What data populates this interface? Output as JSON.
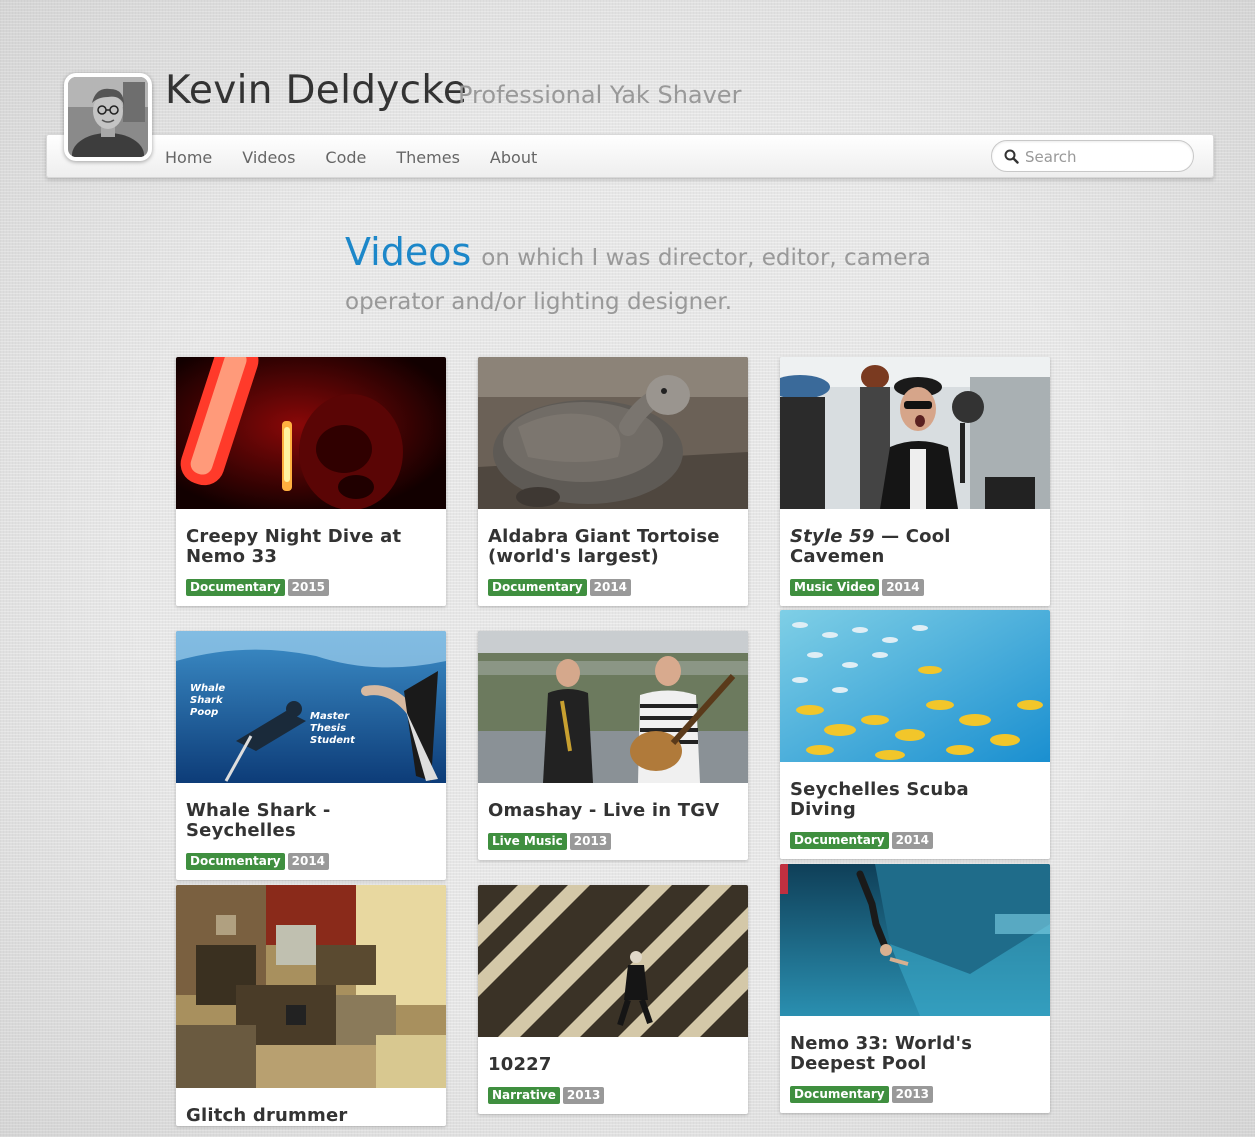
{
  "site": {
    "name": "Kevin Deldycke",
    "tagline": "Professional Yak Shaver"
  },
  "nav": {
    "items": [
      {
        "label": "Home"
      },
      {
        "label": "Videos"
      },
      {
        "label": "Code"
      },
      {
        "label": "Themes"
      },
      {
        "label": "About"
      }
    ]
  },
  "search": {
    "placeholder": "Search",
    "value": "",
    "icon": "search-icon"
  },
  "heading": {
    "title": "Videos",
    "subtitle_line1": "on which I was director, editor, camera",
    "subtitle_line2": "operator and/or lighting designer."
  },
  "videos": [
    {
      "title": "Creepy Night Dive at Nemo 33",
      "genre": "Documentary",
      "year": "2015"
    },
    {
      "title": "Aldabra Giant Tortoise (world's largest)",
      "genre": "Documentary",
      "year": "2014"
    },
    {
      "title_em": "Style 59",
      "title_rest": " — Cool Cavemen",
      "genre": "Music Video",
      "year": "2014"
    },
    {
      "title": "Whale Shark - Seychelles",
      "genre": "Documentary",
      "year": "2014",
      "overlay": {
        "left_line1": "Whale",
        "left_line2": "Shark",
        "left_line3": "Poop",
        "right_line1": "Master",
        "right_line2": "Thesis",
        "right_line3": "Student"
      }
    },
    {
      "title": "Omashay - Live in TGV",
      "genre": "Live Music",
      "year": "2013"
    },
    {
      "title": "Seychelles Scuba Diving",
      "genre": "Documentary",
      "year": "2014"
    },
    {
      "title": "Glitch drummer"
    },
    {
      "title": "10227",
      "genre": "Narrative",
      "year": "2013"
    },
    {
      "title": "Nemo 33: World's Deepest Pool",
      "genre": "Documentary",
      "year": "2013"
    }
  ],
  "colors": {
    "accent": "#1c87c9",
    "genre_tag": "#3f8f3f",
    "year_tag": "#999999"
  }
}
